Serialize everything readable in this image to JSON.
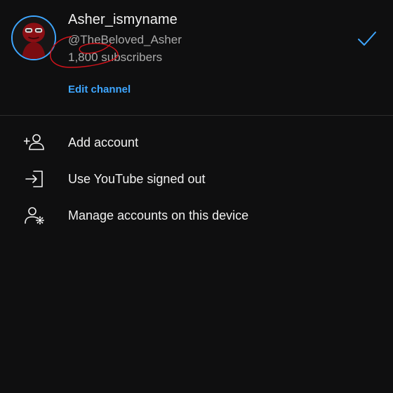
{
  "account": {
    "name": "Asher_ismyname",
    "handle": "@TheBeloved_Asher",
    "subscribers": "1,800 subscribers",
    "edit_label": "Edit channel",
    "selected_icon": "checkmark-icon",
    "avatar_icon": "avatar-image"
  },
  "menu": [
    {
      "label": "Add account",
      "icon": "add-person-icon"
    },
    {
      "label": "Use YouTube signed out",
      "icon": "sign-out-icon"
    },
    {
      "label": "Manage accounts on this device",
      "icon": "manage-accounts-icon"
    }
  ],
  "colors": {
    "background": "#0f0f10",
    "accent": "#3ea6ff",
    "annotation": "#d4131b"
  }
}
